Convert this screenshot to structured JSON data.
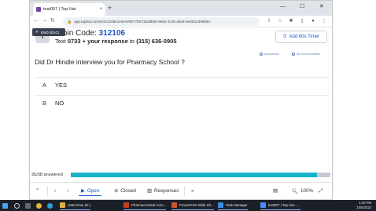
{
  "browser": {
    "tab_title": "test007 | Top Hat",
    "tab_close": "×",
    "new_tab": "+",
    "url": "app.tophat.com/e/312106/content/907700:f1636b60-9eb2-4c26-a844-9e2622309854",
    "controls": {
      "minimize": "—",
      "maximize": "☐",
      "close": "✕"
    }
  },
  "classroom": {
    "esc_label": "END (ESC)",
    "join_prefix": "Join Code: ",
    "join_code": "312106",
    "text_prefix": "Text ",
    "text_code": "0733 + your response",
    "text_to": " to ",
    "text_number": "(315) 636-0905",
    "timer_label": "Add 60s Timer"
  },
  "flags": {
    "anonymous": "Anonymous",
    "no_correct": "No Correct Answer"
  },
  "question": {
    "text": "Did Dr Hindle interview you for Pharmacy School ?",
    "answers": [
      {
        "letter": "A",
        "text": "YES"
      },
      {
        "letter": "B",
        "text": "NO"
      }
    ]
  },
  "progress": {
    "answered_label": "36/38 answered",
    "fraction": 0.947,
    "color": "#16b3c9"
  },
  "toolbar": {
    "open_label": "Open",
    "closed_label": "Closed",
    "responses_label": "Responses",
    "zoom": "100%"
  },
  "taskbar": {
    "items": [
      {
        "label": "USB Drive (D:)",
        "color": "#e0b341"
      },
      {
        "label": "Pharmaceutical Com...",
        "color": "#c43e1c"
      },
      {
        "label": "PowerPoint Slide Sh...",
        "color": "#d35230"
      },
      {
        "label": "Task Manager",
        "color": "#3a8ee6"
      },
      {
        "label": "test007 | Top Hat - ...",
        "color": "#4c8bf5"
      }
    ],
    "time": "1:00 PM",
    "date": "10/5/2022"
  },
  "colors": {
    "accent": "#1a56c7",
    "taskbar": "#1b1f27"
  }
}
